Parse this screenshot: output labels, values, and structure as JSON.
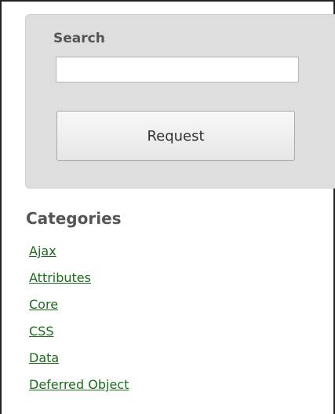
{
  "search": {
    "label": "Search",
    "value": "",
    "placeholder": "",
    "button_label": "Request"
  },
  "categories": {
    "title": "Categories",
    "items": [
      {
        "label": "Ajax"
      },
      {
        "label": "Attributes"
      },
      {
        "label": "Core"
      },
      {
        "label": "CSS"
      },
      {
        "label": "Data"
      },
      {
        "label": "Deferred Object"
      }
    ]
  },
  "colors": {
    "panel_bg": "#dedede",
    "link": "#1a6b1a",
    "heading": "#555555"
  }
}
